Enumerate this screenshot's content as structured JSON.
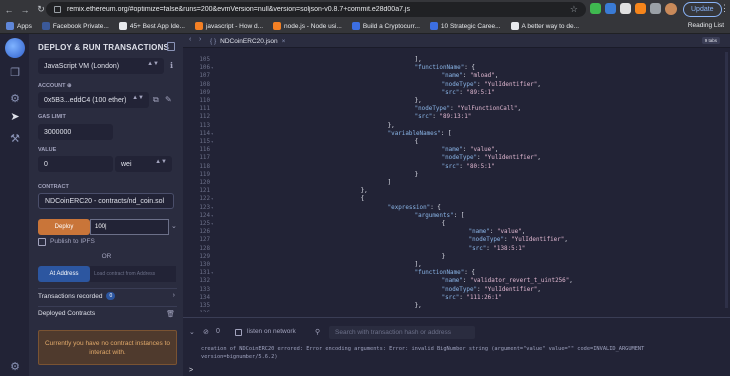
{
  "browser": {
    "url": "remix.ethereum.org/#optimize=false&runs=200&evmVersion=null&version=soljson-v0.8.7+commit.e28d00a7.js",
    "update_label": "Update",
    "bookmarks": [
      {
        "label": "Apps",
        "color": "#5f87d9"
      },
      {
        "label": "Facebook Private...",
        "color": "#3b5998"
      },
      {
        "label": "45+ Best App Ide...",
        "color": "#e8eaed"
      },
      {
        "label": "javascript - How d...",
        "color": "#f48024"
      },
      {
        "label": "node.js - Node usi...",
        "color": "#f48024"
      },
      {
        "label": "Build a Cryptocurr...",
        "color": "#3c6ee0"
      },
      {
        "label": "10 Strategic Caree...",
        "color": "#3c6ee0"
      },
      {
        "label": "A better way to de...",
        "color": "#e8eaed"
      }
    ],
    "reading_list": "Reading List"
  },
  "sidebar": {
    "title": "DEPLOY & RUN TRANSACTIONS",
    "environment": "JavaScript VM (London)",
    "account_label": "ACCOUNT",
    "account_value": "0x5B3...eddC4 (100 ether)",
    "gas_limit_label": "GAS LIMIT",
    "gas_limit_value": "3000000",
    "value_label": "VALUE",
    "value_amount": "0",
    "value_unit": "wei",
    "contract_label": "CONTRACT",
    "contract_value": "NDCoinERC20 - contracts/nd_coin.sol",
    "deploy_label": "Deploy",
    "deploy_input": "100|",
    "publish_label": "Publish to IPFS",
    "or_label": "OR",
    "at_address_label": "At Address",
    "at_address_placeholder": "Load contract from Address",
    "transactions_label": "Transactions recorded",
    "transactions_count": "0",
    "deployed_label": "Deployed Contracts",
    "notice": "Currently you have no contract instances to interact with."
  },
  "editor": {
    "tab_name": "NDCoinERC20.json",
    "zoom_label": "9 tabs",
    "lines": [
      {
        "n": "105",
        "fold": false,
        "indent": 29,
        "parts": [
          [
            "p",
            "],"
          ]
        ]
      },
      {
        "n": "106",
        "fold": true,
        "indent": 29,
        "parts": [
          [
            "k",
            "\"functionName\""
          ],
          [
            "p",
            ": {"
          ]
        ]
      },
      {
        "n": "107",
        "fold": false,
        "indent": 33,
        "parts": [
          [
            "k",
            "\"name\""
          ],
          [
            "p",
            ": "
          ],
          [
            "s",
            "\"mload\""
          ],
          [
            "p",
            ","
          ]
        ]
      },
      {
        "n": "108",
        "fold": false,
        "indent": 33,
        "parts": [
          [
            "k",
            "\"nodeType\""
          ],
          [
            "p",
            ": "
          ],
          [
            "s",
            "\"YulIdentifier\""
          ],
          [
            "p",
            ","
          ]
        ]
      },
      {
        "n": "109",
        "fold": false,
        "indent": 33,
        "parts": [
          [
            "k",
            "\"src\""
          ],
          [
            "p",
            ": "
          ],
          [
            "s",
            "\"89:5:1\""
          ]
        ]
      },
      {
        "n": "110",
        "fold": false,
        "indent": 29,
        "parts": [
          [
            "p",
            "},"
          ]
        ]
      },
      {
        "n": "111",
        "fold": false,
        "indent": 29,
        "parts": [
          [
            "k",
            "\"nodeType\""
          ],
          [
            "p",
            ": "
          ],
          [
            "s",
            "\"YulFunctionCall\""
          ],
          [
            "p",
            ","
          ]
        ]
      },
      {
        "n": "112",
        "fold": false,
        "indent": 29,
        "parts": [
          [
            "k",
            "\"src\""
          ],
          [
            "p",
            ": "
          ],
          [
            "s",
            "\"89:13:1\""
          ]
        ]
      },
      {
        "n": "113",
        "fold": false,
        "indent": 25,
        "parts": [
          [
            "p",
            "},"
          ]
        ]
      },
      {
        "n": "114",
        "fold": true,
        "indent": 25,
        "parts": [
          [
            "k",
            "\"variableNames\""
          ],
          [
            "p",
            ": ["
          ]
        ]
      },
      {
        "n": "115",
        "fold": true,
        "indent": 29,
        "parts": [
          [
            "p",
            "{"
          ]
        ]
      },
      {
        "n": "116",
        "fold": false,
        "indent": 33,
        "parts": [
          [
            "k",
            "\"name\""
          ],
          [
            "p",
            ": "
          ],
          [
            "s",
            "\"value\""
          ],
          [
            "p",
            ","
          ]
        ]
      },
      {
        "n": "117",
        "fold": false,
        "indent": 33,
        "parts": [
          [
            "k",
            "\"nodeType\""
          ],
          [
            "p",
            ": "
          ],
          [
            "s",
            "\"YulIdentifier\""
          ],
          [
            "p",
            ","
          ]
        ]
      },
      {
        "n": "118",
        "fold": false,
        "indent": 33,
        "parts": [
          [
            "k",
            "\"src\""
          ],
          [
            "p",
            ": "
          ],
          [
            "s",
            "\"80:5:1\""
          ]
        ]
      },
      {
        "n": "119",
        "fold": false,
        "indent": 29,
        "parts": [
          [
            "p",
            "}"
          ]
        ]
      },
      {
        "n": "120",
        "fold": false,
        "indent": 25,
        "parts": [
          [
            "p",
            "]"
          ]
        ]
      },
      {
        "n": "121",
        "fold": false,
        "indent": 21,
        "parts": [
          [
            "p",
            "},"
          ]
        ]
      },
      {
        "n": "122",
        "fold": true,
        "indent": 21,
        "parts": [
          [
            "p",
            "{"
          ]
        ]
      },
      {
        "n": "123",
        "fold": true,
        "indent": 25,
        "parts": [
          [
            "k",
            "\"expression\""
          ],
          [
            "p",
            ": {"
          ]
        ]
      },
      {
        "n": "124",
        "fold": true,
        "indent": 29,
        "parts": [
          [
            "k",
            "\"arguments\""
          ],
          [
            "p",
            ": ["
          ]
        ]
      },
      {
        "n": "125",
        "fold": true,
        "indent": 33,
        "parts": [
          [
            "p",
            "{"
          ]
        ]
      },
      {
        "n": "126",
        "fold": false,
        "indent": 37,
        "parts": [
          [
            "k",
            "\"name\""
          ],
          [
            "p",
            ": "
          ],
          [
            "s",
            "\"value\""
          ],
          [
            "p",
            ","
          ]
        ]
      },
      {
        "n": "127",
        "fold": false,
        "indent": 37,
        "parts": [
          [
            "k",
            "\"nodeType\""
          ],
          [
            "p",
            ": "
          ],
          [
            "s",
            "\"YulIdentifier\""
          ],
          [
            "p",
            ","
          ]
        ]
      },
      {
        "n": "128",
        "fold": false,
        "indent": 37,
        "parts": [
          [
            "k",
            "\"src\""
          ],
          [
            "p",
            ": "
          ],
          [
            "s",
            "\"138:5:1\""
          ]
        ]
      },
      {
        "n": "129",
        "fold": false,
        "indent": 33,
        "parts": [
          [
            "p",
            "}"
          ]
        ]
      },
      {
        "n": "130",
        "fold": false,
        "indent": 29,
        "parts": [
          [
            "p",
            "],"
          ]
        ]
      },
      {
        "n": "131",
        "fold": true,
        "indent": 29,
        "parts": [
          [
            "k",
            "\"functionName\""
          ],
          [
            "p",
            ": {"
          ]
        ]
      },
      {
        "n": "132",
        "fold": false,
        "indent": 33,
        "parts": [
          [
            "k",
            "\"name\""
          ],
          [
            "p",
            ": "
          ],
          [
            "s",
            "\"validator_revert_t_uint256\""
          ],
          [
            "p",
            ","
          ]
        ]
      },
      {
        "n": "133",
        "fold": false,
        "indent": 33,
        "parts": [
          [
            "k",
            "\"nodeType\""
          ],
          [
            "p",
            ": "
          ],
          [
            "s",
            "\"YulIdentifier\""
          ],
          [
            "p",
            ","
          ]
        ]
      },
      {
        "n": "134",
        "fold": false,
        "indent": 33,
        "parts": [
          [
            "k",
            "\"src\""
          ],
          [
            "p",
            ": "
          ],
          [
            "s",
            "\"111:26:1\""
          ]
        ]
      },
      {
        "n": "135",
        "fold": false,
        "indent": 29,
        "parts": [
          [
            "p",
            "},"
          ]
        ]
      },
      {
        "n": "136",
        "fold": false,
        "indent": 0,
        "parts": []
      }
    ]
  },
  "terminal": {
    "count": "0",
    "listen_label": "listen on network",
    "search_placeholder": "Search with transaction hash or address",
    "log": "creation of NDCoinERC20 errored: Error encoding arguments: Error: invalid BigNumber string (argument=\"value\" value=\"\" code=INVALID_ARGUMENT version=bignumber/5.6.2)",
    "prompt": ">"
  }
}
